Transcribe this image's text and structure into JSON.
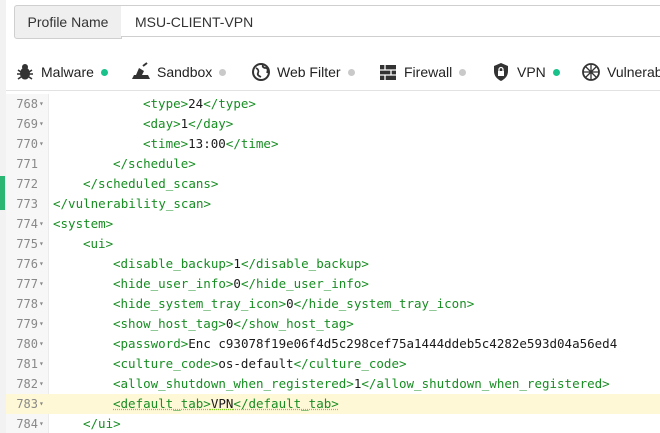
{
  "profile": {
    "label": "Profile Name",
    "value": "MSU-CLIENT-VPN"
  },
  "tabs": [
    {
      "label": "Malware",
      "icon": "bug-icon",
      "enabled": true
    },
    {
      "label": "Sandbox",
      "icon": "sandbox-icon",
      "enabled": false
    },
    {
      "label": "Web Filter",
      "icon": "globe-icon",
      "enabled": false
    },
    {
      "label": "Firewall",
      "icon": "firewall-icon",
      "enabled": false
    },
    {
      "label": "VPN",
      "icon": "shield-lock-icon",
      "enabled": true
    },
    {
      "label": "Vulnerab",
      "icon": "vulnerability-icon",
      "enabled": false
    }
  ],
  "colors": {
    "tag": "#178d22",
    "accent": "#19c28a",
    "active_line": "#fff8d6"
  },
  "editor": {
    "lines": [
      {
        "num": "768",
        "fold": true,
        "indent": 6,
        "open": "<type>",
        "text": "24",
        "close": "</type>"
      },
      {
        "num": "769",
        "fold": true,
        "indent": 6,
        "open": "<day>",
        "text": "1",
        "close": "</day>"
      },
      {
        "num": "770",
        "fold": true,
        "indent": 6,
        "open": "<time>",
        "text": "13:00",
        "close": "</time>"
      },
      {
        "num": "771",
        "fold": false,
        "indent": 4,
        "open": "</schedule>",
        "text": "",
        "close": ""
      },
      {
        "num": "772",
        "fold": false,
        "indent": 2,
        "open": "</scheduled_scans>",
        "text": "",
        "close": ""
      },
      {
        "num": "773",
        "fold": false,
        "indent": 0,
        "open": "</vulnerability_scan>",
        "text": "",
        "close": ""
      },
      {
        "num": "774",
        "fold": true,
        "indent": 0,
        "open": "<system>",
        "text": "",
        "close": ""
      },
      {
        "num": "775",
        "fold": true,
        "indent": 2,
        "open": "<ui>",
        "text": "",
        "close": ""
      },
      {
        "num": "776",
        "fold": true,
        "indent": 4,
        "open": "<disable_backup>",
        "text": "1",
        "close": "</disable_backup>"
      },
      {
        "num": "777",
        "fold": true,
        "indent": 4,
        "open": "<hide_user_info>",
        "text": "0",
        "close": "</hide_user_info>"
      },
      {
        "num": "778",
        "fold": true,
        "indent": 4,
        "open": "<hide_system_tray_icon>",
        "text": "0",
        "close": "</hide_system_tray_icon>"
      },
      {
        "num": "779",
        "fold": true,
        "indent": 4,
        "open": "<show_host_tag>",
        "text": "0",
        "close": "</show_host_tag>"
      },
      {
        "num": "780",
        "fold": true,
        "indent": 4,
        "open": "<password>",
        "text": "Enc c93078f19e06f4d5c298cef75a1444ddeb5c4282e593d04a56ed4",
        "close": ""
      },
      {
        "num": "781",
        "fold": true,
        "indent": 4,
        "open": "<culture_code>",
        "text": "os-default",
        "close": "</culture_code>"
      },
      {
        "num": "782",
        "fold": true,
        "indent": 4,
        "open": "<allow_shutdown_when_registered>",
        "text": "1",
        "close": "</allow_shutdown_when_registered>"
      },
      {
        "num": "783",
        "fold": true,
        "indent": 4,
        "open": "<default_tab>",
        "text": "VPN",
        "close": "</default_tab>",
        "active": true
      },
      {
        "num": "784",
        "fold": true,
        "indent": 2,
        "open": "</ui>",
        "text": "",
        "close": ""
      }
    ]
  }
}
